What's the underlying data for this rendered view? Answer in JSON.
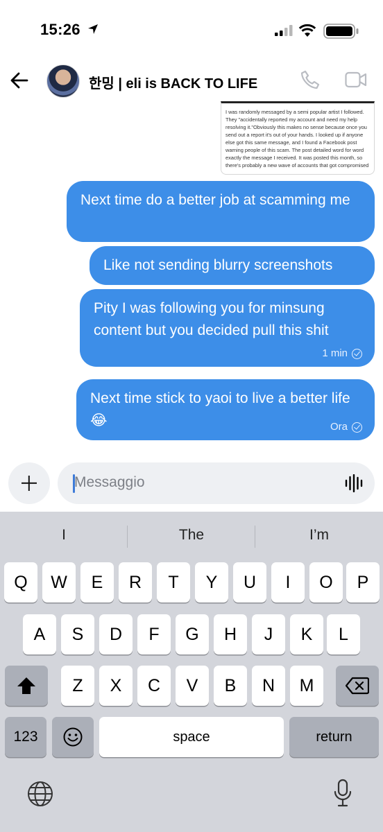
{
  "status_bar": {
    "time": "15:26"
  },
  "header": {
    "title": "한밍 | eli is BACK TO LIFE"
  },
  "forwarded_screenshot": {
    "text": "I was randomly messaged by a semi popular artist I followed. They \"accidentally reported my account and need my help resolving it.\"Obviously this makes no sense because once you send out a report it's out of your hands. I looked up if anyone else got this same message, and I found a Facebook post warning people of this scam. The post detailed word for word exactly the message I received. It was posted this month, so there's probably a new wave of accounts that got compromised"
  },
  "messages": [
    {
      "text": "Next time do a better job at scamming me"
    },
    {
      "text": "Like not sending blurry screenshots"
    },
    {
      "text": "Pity I was following you for minsung content but you decided pull this shit",
      "time": "1 min"
    },
    {
      "text": "Next time stick to yaoi to live a better life 😂",
      "time": "Ora"
    }
  ],
  "composer": {
    "placeholder": "Messaggio"
  },
  "keyboard": {
    "suggestions": [
      "I",
      "The",
      "I’m"
    ],
    "row1": [
      "Q",
      "W",
      "E",
      "R",
      "T",
      "Y",
      "U",
      "I",
      "O",
      "P"
    ],
    "row2": [
      "A",
      "S",
      "D",
      "F",
      "G",
      "H",
      "J",
      "K",
      "L"
    ],
    "row3": [
      "Z",
      "X",
      "C",
      "V",
      "B",
      "N",
      "M"
    ],
    "numbers_label": "123",
    "space_label": "space",
    "return_label": "return"
  },
  "colors": {
    "bubble": "#3d8ee8",
    "keyboard_bg": "#d3d5db",
    "accent": "#3d7bd8"
  }
}
